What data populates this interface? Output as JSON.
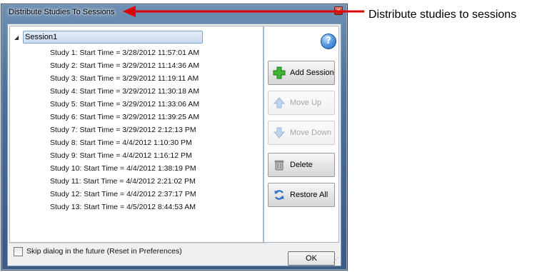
{
  "window": {
    "title": "Distribute Studies To Sessions",
    "close_glyph": "x"
  },
  "tree": {
    "session_label": "Session1",
    "expand_glyph": "◢",
    "studies": [
      "Study 1: Start Time = 3/28/2012 11:57:01 AM",
      "Study 2: Start Time = 3/29/2012 11:14:36 AM",
      "Study 3: Start Time = 3/29/2012 11:19:11 AM",
      "Study 4: Start Time = 3/29/2012 11:30:18 AM",
      "Study 5: Start Time = 3/29/2012 11:33:06 AM",
      "Study 6: Start Time = 3/29/2012 11:39:25 AM",
      "Study 7: Start Time = 3/29/2012 2:12:13 PM",
      "Study 8: Start Time = 4/4/2012 1:10:30 PM",
      "Study 9: Start Time = 4/4/2012 1:16:12 PM",
      "Study 10: Start Time = 4/4/2012 1:38:19 PM",
      "Study 11: Start Time = 4/4/2012 2:21:02 PM",
      "Study 12: Start Time = 4/4/2012 2:37:17 PM",
      "Study 13: Start Time = 4/5/2012 8:44:53 AM"
    ]
  },
  "options": {
    "skip_label": "Skip dialog in the future (Reset in Preferences)",
    "skip_checked": false
  },
  "buttons": {
    "help_glyph": "?",
    "add_session": "Add Session",
    "move_up": "Move Up",
    "move_down": "Move Down",
    "delete": "Delete",
    "restore_all": "Restore All",
    "ok": "OK"
  },
  "icons": {
    "add": "plus-icon",
    "up": "arrow-up-icon",
    "down": "arrow-down-icon",
    "delete": "trash-icon",
    "restore": "restore-icon",
    "help": "help-icon"
  },
  "annotation": {
    "text": "Distribute studies to sessions",
    "color": "#e00000"
  }
}
